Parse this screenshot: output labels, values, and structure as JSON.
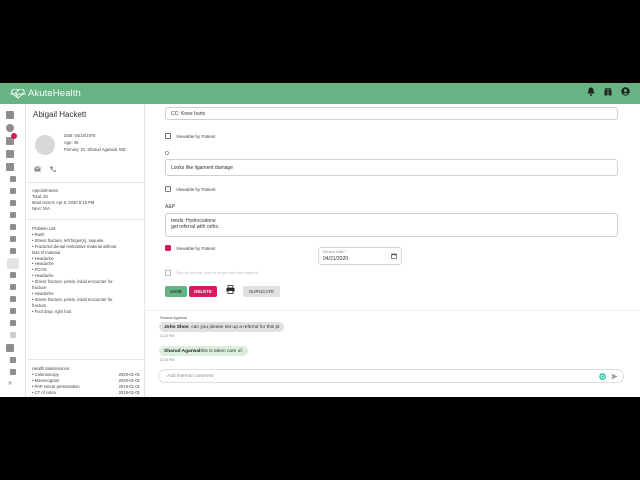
{
  "brand": {
    "name": "AkuteHealth",
    "color": "#66b383"
  },
  "header_icons": [
    "bell-icon",
    "gift-icon",
    "account-icon"
  ],
  "patient": {
    "name": "Abigail Hackett",
    "dob": "DoB: 04/16/1975",
    "age": "Age: 45",
    "primary": "Primary: Dr. Sharud Agarwal, MD",
    "appointments_title": "Appointments:",
    "appointments": [
      "Total: 25",
      "Most recent: Apr 8, 2020 8:15 PM",
      "Next: N/A"
    ],
    "problem_title": "Problem List:",
    "problems": [
      "• Rash",
      "• Stress fracture, left finger(s), sequela",
      "• Fractured dental restorative material without",
      "loss of material",
      "• Headache",
      "• Headache",
      "• PCOS",
      "• Headache",
      "• Stress fracture, pelvis, initial encounter for",
      "fracture",
      "• Headache",
      "• Stress fracture, pelvis, initial encounter for",
      "fracture",
      "• Foot drop, right foot"
    ],
    "hm_title": "Health Maintenance:",
    "hm": [
      {
        "name": "• Colonoscopy",
        "date": "2020-01-01"
      },
      {
        "name": "• Mammogram",
        "date": "2020-01-01"
      },
      {
        "name": "• PAP smear presentation",
        "date": "2019-01-01"
      },
      {
        "name": "• CT of colon",
        "date": "2019-01-01"
      }
    ]
  },
  "note": {
    "cc_value": "CC: Knee hurts",
    "viewable_label": "Viewable by Patient",
    "viewable_label_checked": "Viewable by Patient",
    "o_label": "O",
    "o_value": "Looks like ligament damage",
    "ap_label": "A&P",
    "ap_line1": "meds: Hydrocodone",
    "ap_line2": "get referral with ortho.",
    "service_date_label": "Service Date *",
    "service_date": "04/21/2020",
    "signoff_label": "Sign off on note (can no longer edit once signed)",
    "viewable_states": [
      false,
      false,
      true
    ]
  },
  "buttons": {
    "save": "SAVE",
    "delete": "DELETE",
    "duplicate": "DUPLICATE",
    "save_color": "#66b383",
    "delete_color": "#d81b60"
  },
  "messages": [
    {
      "author": "Sharud Agarwal",
      "mention": "John Shoe",
      "text": ", can you please set up a referral for this pt",
      "time": "11:32 PM",
      "color": "#e0e0e0"
    },
    {
      "author": "",
      "mention": "Sharud Agarwal",
      "text": " this is taken care of.",
      "time": "11:33 PM",
      "color": "#dcefdc"
    }
  ],
  "comment_placeholder": "Add internal comment"
}
